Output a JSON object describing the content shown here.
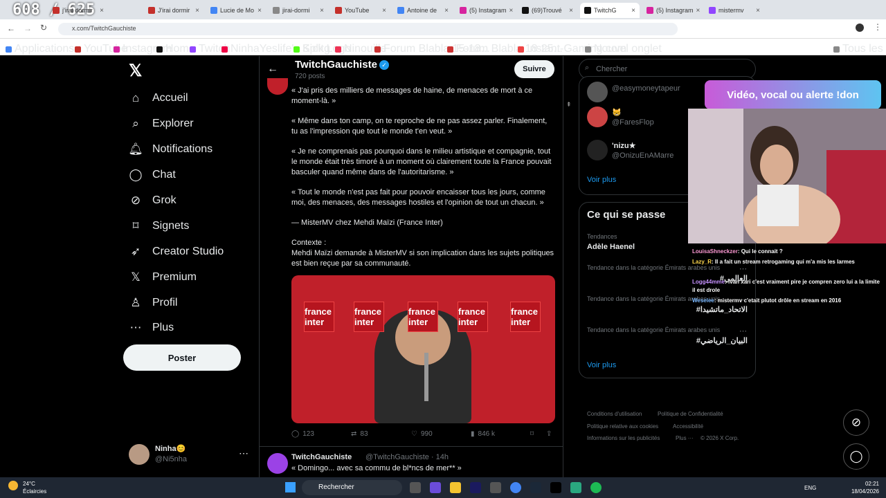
{
  "counter": "608 / 625",
  "tabs": [
    {
      "label": "j'irai dormir",
      "color": "#c4302b"
    },
    {
      "label": "J'irai dormir",
      "color": "#c4302b"
    },
    {
      "label": "Lucie de Mo",
      "color": "#4285f4"
    },
    {
      "label": "jirai-dormi",
      "color": "#888"
    },
    {
      "label": "YouTube",
      "color": "#c4302b"
    },
    {
      "label": "Antoine de",
      "color": "#4285f4"
    },
    {
      "label": "(5) Instagram",
      "color": "#d6249f"
    },
    {
      "label": "(69)Trouvé",
      "color": "#111"
    },
    {
      "label": "TwitchG",
      "color": "#111"
    },
    {
      "label": "(5) Instagram",
      "color": "#d6249f"
    },
    {
      "label": "mistermv",
      "color": "#9146ff"
    }
  ],
  "url": "x.com/TwitchGauchiste",
  "bookmarks": [
    "Applications",
    "YouTube",
    "Instagram",
    "Home",
    "Twitch",
    "NinhaYeslife's Splitg...",
    "Kick Logo",
    "Ninouille",
    "Forum Blabla 15-18...",
    "Forum Blabla 18-25...",
    "Instant-Gaming.com",
    "Nouvel onglet",
    "Tous les favoris"
  ],
  "nav": [
    {
      "label": "Accueil",
      "icon": "home-icon",
      "glyph": "⌂"
    },
    {
      "label": "Explorer",
      "icon": "search-icon",
      "glyph": "⌕"
    },
    {
      "label": "Notifications",
      "icon": "bell-icon",
      "glyph": "🔔︎"
    },
    {
      "label": "Chat",
      "icon": "chat-icon",
      "glyph": "◯"
    },
    {
      "label": "Grok",
      "icon": "grok-icon",
      "glyph": "⊘"
    },
    {
      "label": "Signets",
      "icon": "bookmark-icon",
      "glyph": "⌑"
    },
    {
      "label": "Creator Studio",
      "icon": "rocket-icon",
      "glyph": "➶"
    },
    {
      "label": "Premium",
      "icon": "x-premium-icon",
      "glyph": "𝕏"
    },
    {
      "label": "Profil",
      "icon": "profile-icon",
      "glyph": "♙"
    },
    {
      "label": "Plus",
      "icon": "more-icon",
      "glyph": "⋯"
    }
  ],
  "post_button": "Poster",
  "account": {
    "name": "Ninha😊",
    "handle": "@Ni5nha"
  },
  "profile_header": {
    "name": "TwitchGauchiste",
    "posts": "720 posts",
    "follow": "Suivre"
  },
  "tweet": {
    "paragraphs": [
      "« J'ai pris des milliers de messages de haine, de menaces de mort à ce moment-là. »",
      "« Même dans ton camp, on te reproche de ne pas assez parler. Finalement, tu as l'impression que tout le monde t'en veut. »",
      "« Je ne comprenais pas pourquoi dans le milieu artistique et compagnie, tout le monde était très timoré à un moment où clairement toute la France pouvait basculer quand même dans de l'autoritarisme. »",
      "« Tout le monde n'est pas fait pour pouvoir encaisser tous les jours, comme moi, des menaces, des messages hostiles et l'opinion de tout un chacun. »",
      "— MisterMV chez Mehdi Maïzi (France Inter)",
      "Contexte :",
      "Mehdi Maïzi demande à MisterMV si son implication dans les sujets politiques est bien reçue par sa communauté."
    ],
    "media_logos": [
      "france inter",
      "france inter",
      "france inter",
      "france inter",
      "france inter"
    ],
    "stats": {
      "replies": "123",
      "reposts": "83",
      "likes": "990",
      "views": "846 k"
    }
  },
  "next_tweet": {
    "name": "TwitchGauchiste",
    "handle": "@TwitchGauchiste · 14h",
    "text": "« Domingo... avec sa commu de bl*ncs de mer** »"
  },
  "search_placeholder": "Chercher",
  "follow_suggestions": [
    {
      "name": "",
      "handle": "@easymoneytapeur"
    },
    {
      "name": "😸",
      "handle": "@FaresFlop"
    },
    {
      "name": "'nizu★",
      "handle": "@OnizuEnAMarre"
    }
  ],
  "voir_plus": "Voir plus",
  "trends": {
    "title": "Ce qui se passe",
    "items": [
      {
        "meta": "Tendances",
        "name": "Adèle Haenel"
      },
      {
        "meta": "Tendance dans la catégorie Émirats arabes unis",
        "name": "#العالمي"
      },
      {
        "meta": "Tendance dans la catégorie Émirats arabes unis",
        "name": "#الاتحاد_ماتشيدا"
      },
      {
        "meta": "Tendance dans la catégorie Émirats arabes unis",
        "name": "#البيان_الرياضي"
      }
    ],
    "more": "Voir plus"
  },
  "footer": [
    "Conditions d'utilisation",
    "Politique de Confidentialité",
    "Politique relative aux cookies",
    "Accessibilité",
    "Informations sur les publicités",
    "Plus ···",
    "© 2026 X Corp."
  ],
  "stream": {
    "banner": "Vidéo, vocal ou alerte !don",
    "chat": [
      {
        "user": "LouisaShneckzer",
        "color": "#ff9ad5",
        "msg": "Qui le connait ?"
      },
      {
        "user": "Lazy_R",
        "color": "#ffd84d",
        "msg": "Il a fait un stream retrogaming qui m'a mis les larmes"
      },
      {
        "user": "Logg44mme",
        "color": "#c792ff",
        "msg": "Ivan xari c'est vraiment pire je compren zero lui a la limite il est drole"
      },
      {
        "user": "Weselee",
        "color": "#7ab8ff",
        "msg": "mistermv c'etait plutot drôle en stream en 2016"
      }
    ]
  },
  "taskbar": {
    "weather_temp": "24°C",
    "weather_desc": "Éclaircies",
    "search": "Rechercher",
    "lang": "ENG",
    "time": "02:21",
    "date": "18/04/2026"
  }
}
